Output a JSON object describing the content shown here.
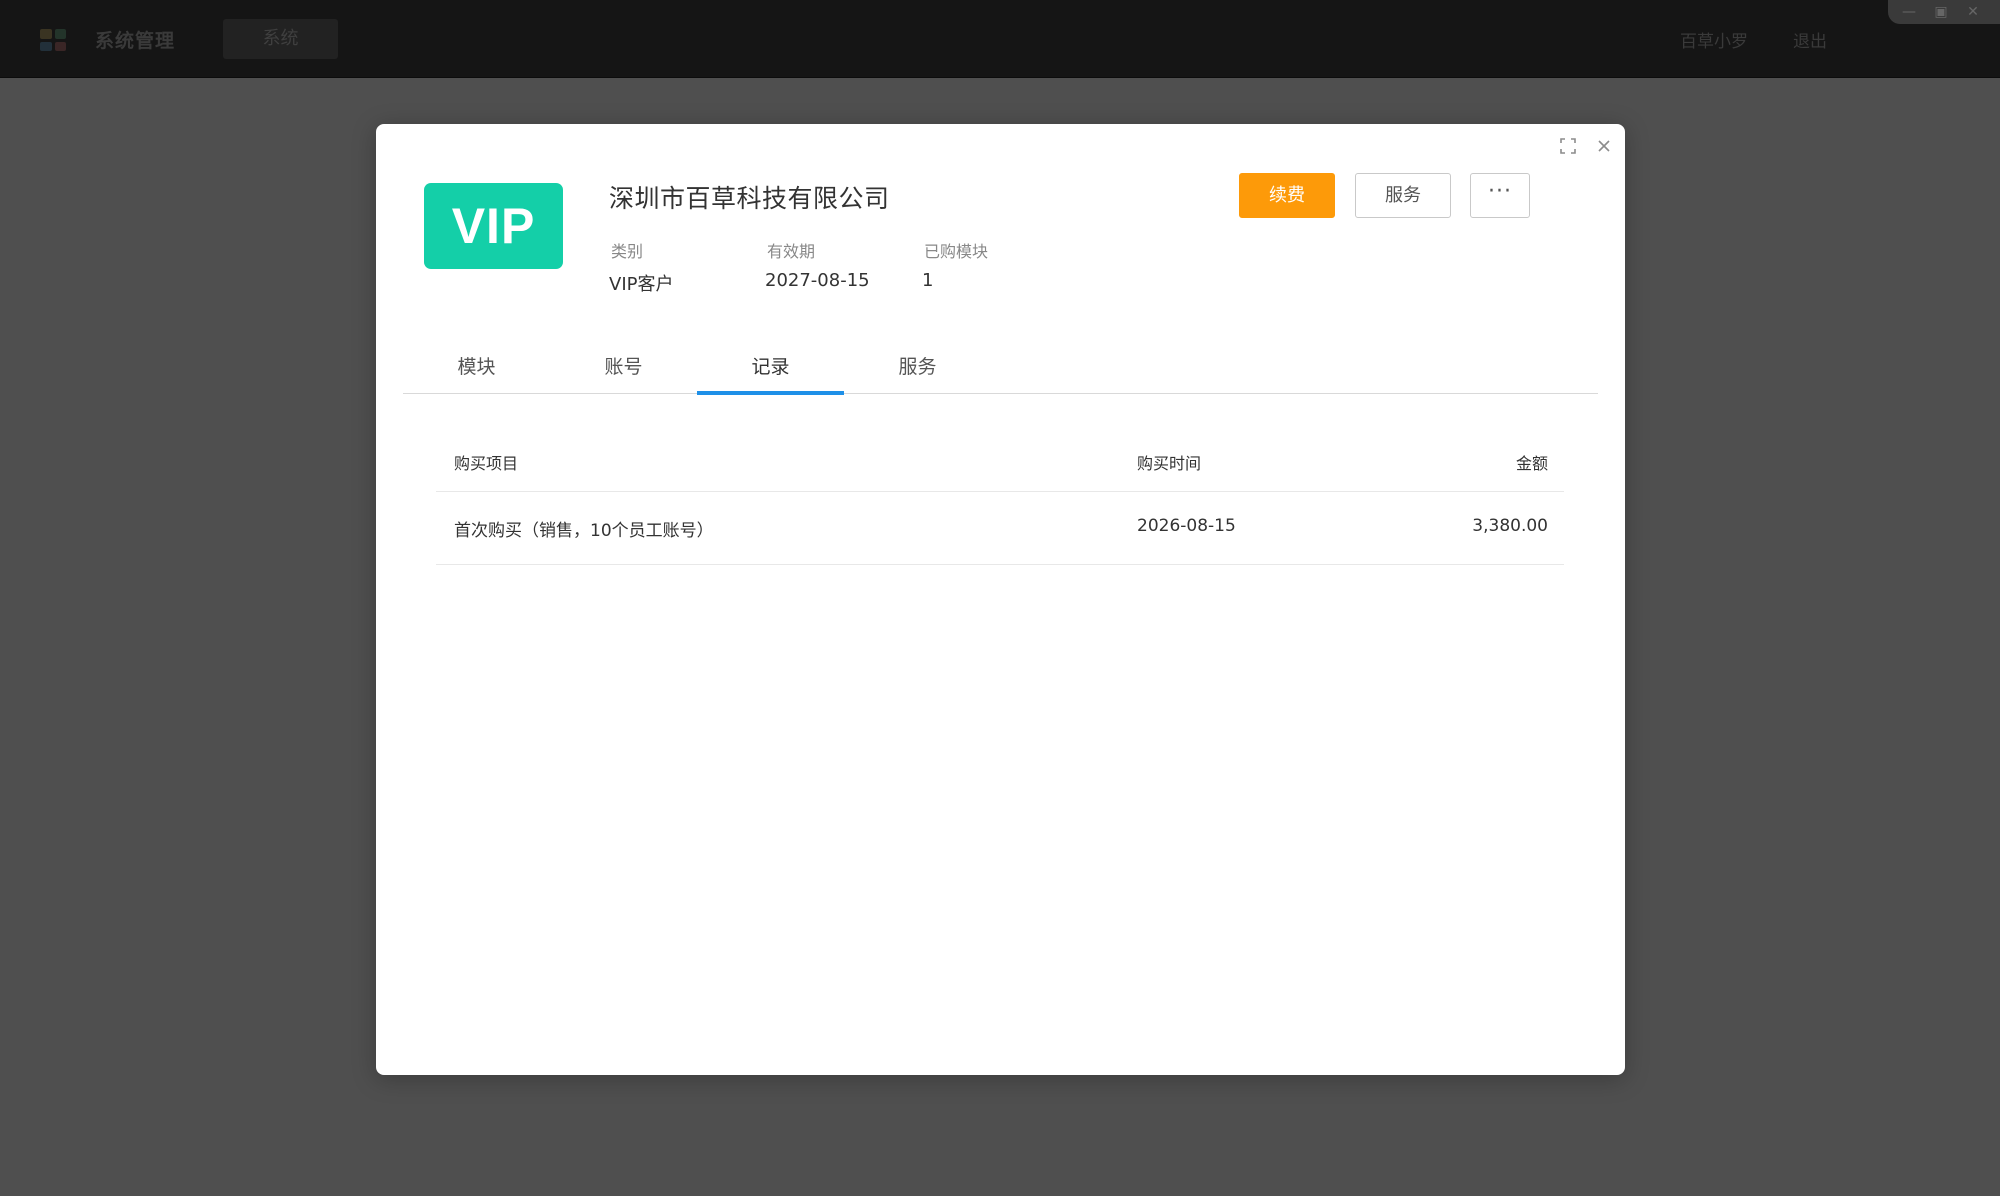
{
  "topbar": {
    "app_title": "系统管理",
    "tab_label": "系统",
    "user_name": "百草小罗",
    "logout_label": "退出"
  },
  "modal": {
    "badge_text": "VIP",
    "company_name": "深圳市百草科技有限公司",
    "meta": [
      {
        "label": "类别",
        "value": "VIP客户"
      },
      {
        "label": "有效期",
        "value": "2027-08-15"
      },
      {
        "label": "已购模块",
        "value": "1"
      }
    ],
    "buttons": {
      "renew": "续费",
      "service": "服务",
      "more": "···"
    },
    "tabs": [
      {
        "label": "模块",
        "active": false
      },
      {
        "label": "账号",
        "active": false
      },
      {
        "label": "记录",
        "active": true
      },
      {
        "label": "服务",
        "active": false
      }
    ],
    "table": {
      "columns": [
        "购买项目",
        "购买时间",
        "金额"
      ],
      "rows": [
        {
          "item": "首次购买（销售，10个员工账号）",
          "time": "2026-08-15",
          "amount": "3,380.00"
        }
      ]
    }
  },
  "colors": {
    "badge": "#14cfa8",
    "renew_button": "#fd9a09",
    "active_tab_underline": "#1e90e8",
    "overlay": "#4f4f4f"
  },
  "icons": {
    "maximize": "expand-icon",
    "close": "close-icon",
    "app_logo": "grid-logo-icon"
  }
}
